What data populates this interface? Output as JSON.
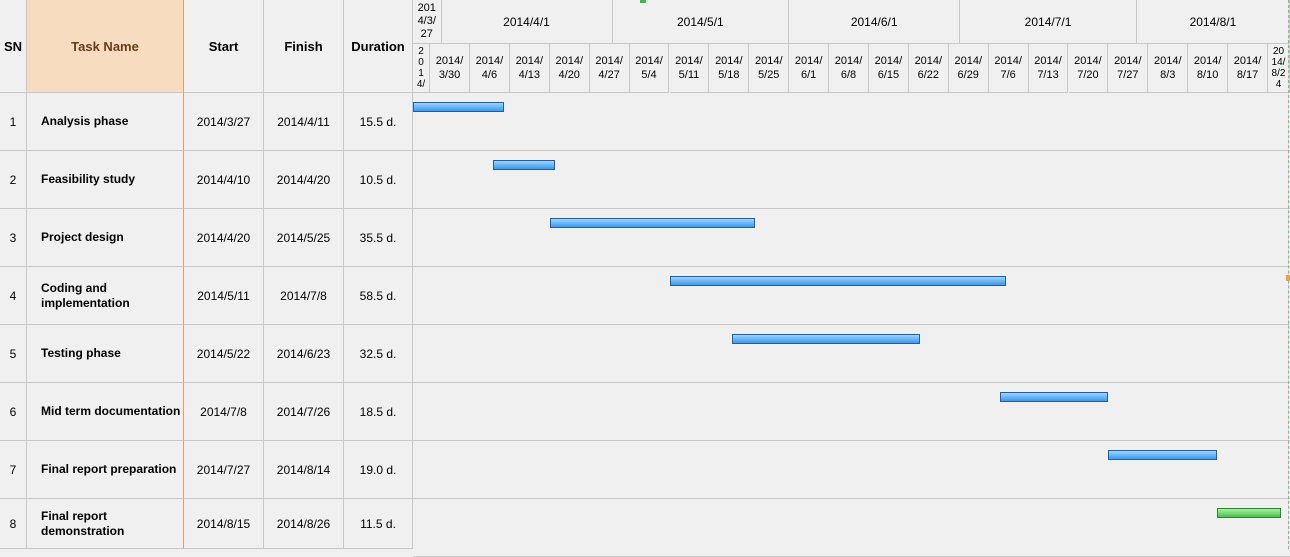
{
  "columns": {
    "sn": "SN",
    "task": "Task Name",
    "start": "Start",
    "finish": "Finish",
    "duration": "Duration"
  },
  "timeline": {
    "first_period": "201\n4/3/\n27",
    "months": [
      "2014/4/1",
      "2014/5/1",
      "2014/6/1",
      "2014/7/1",
      "2014/8/1"
    ],
    "first_week": "2\n0\n1\n4/",
    "weeks": [
      "2014/\n3/30",
      "2014/\n4/6",
      "2014/\n4/13",
      "2014/\n4/20",
      "2014/\n4/27",
      "2014/\n5/4",
      "2014/\n5/11",
      "2014/\n5/18",
      "2014/\n5/25",
      "2014/\n6/1",
      "2014/\n6/8",
      "2014/\n6/15",
      "2014/\n6/22",
      "2014/\n6/29",
      "2014/\n7/6",
      "2014/\n7/13",
      "2014/\n7/20",
      "2014/\n7/27",
      "2014/\n8/3",
      "2014/\n8/10",
      "2014/\n8/17"
    ],
    "last_week": "20\n14/\n8/2\n4"
  },
  "chart_data": {
    "type": "gantt",
    "tasks": [
      {
        "sn": "1",
        "name": "Analysis phase",
        "start": "2014/3/27",
        "finish": "2014/4/11",
        "duration": "15.5 d.",
        "color": "#3c9ae8"
      },
      {
        "sn": "2",
        "name": "Feasibility study",
        "start": "2014/4/10",
        "finish": "2014/4/20",
        "duration": "10.5 d.",
        "color": "#3c9ae8"
      },
      {
        "sn": "3",
        "name": "Project design",
        "start": "2014/4/20",
        "finish": "2014/5/25",
        "duration": "35.5 d.",
        "color": "#3c9ae8"
      },
      {
        "sn": "4",
        "name": "Coding and implementation",
        "start": "2014/5/11",
        "finish": "2014/7/8",
        "duration": "58.5 d.",
        "color": "#3c9ae8"
      },
      {
        "sn": "5",
        "name": "Testing phase",
        "start": "2014/5/22",
        "finish": "2014/6/23",
        "duration": "32.5 d.",
        "color": "#3c9ae8"
      },
      {
        "sn": "6",
        "name": "Mid term documentation",
        "start": "2014/7/8",
        "finish": "2014/7/26",
        "duration": "18.5 d.",
        "color": "#3c9ae8"
      },
      {
        "sn": "7",
        "name": "Final report preparation",
        "start": "2014/7/27",
        "finish": "2014/8/14",
        "duration": "19.0 d.",
        "color": "#3c9ae8"
      },
      {
        "sn": "8",
        "name": "Final report demonstration",
        "start": "2014/8/15",
        "finish": "2014/8/26",
        "duration": "11.5 d.",
        "color": "#4cc04c"
      }
    ]
  }
}
